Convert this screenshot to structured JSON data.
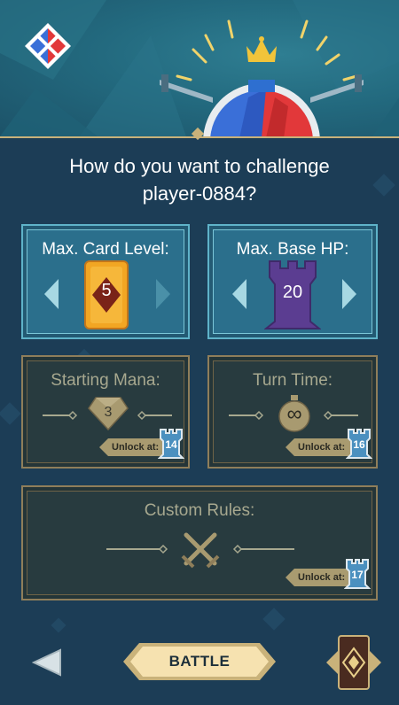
{
  "title_line1": "How do you want to challenge",
  "title_line2": "player-0884?",
  "card_level": {
    "label": "Max. Card Level:",
    "value": "5"
  },
  "base_hp": {
    "label": "Max. Base HP:",
    "value": "20"
  },
  "starting_mana": {
    "label": "Starting Mana:",
    "value": "3",
    "unlock_label": "Unlock at:",
    "unlock_level": "14"
  },
  "turn_time": {
    "label": "Turn Time:",
    "value": "∞",
    "unlock_label": "Unlock at:",
    "unlock_level": "16"
  },
  "custom_rules": {
    "label": "Custom Rules:",
    "unlock_label": "Unlock at:",
    "unlock_level": "17"
  },
  "footer": {
    "battle_label": "BATTLE"
  },
  "colors": {
    "gold": "#c9b27a",
    "teal": "#2b6f8c",
    "locked": "#283b3f"
  }
}
